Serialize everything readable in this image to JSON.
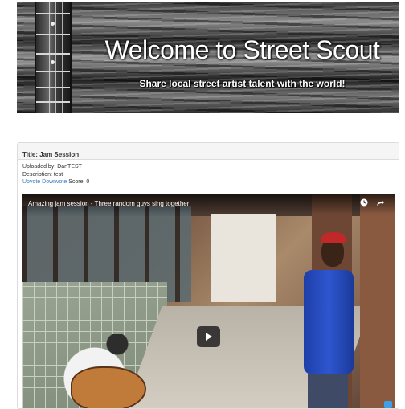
{
  "banner": {
    "title": "Welcome to Street Scout",
    "subtitle": "Share local street artist talent with the world!"
  },
  "post": {
    "title": "Title: Jam Session",
    "uploaded_by": "Uploaded by: DanTEST",
    "description": "Description: test",
    "upvote_label": "Upvote",
    "downvote_label": "Downvote",
    "score": "Score: 0"
  },
  "video": {
    "title": "Amazing jam session - Three random guys sing together",
    "icons": [
      "clock-icon",
      "share-icon",
      "play-icon"
    ]
  },
  "colors": {
    "link": "#337ab7",
    "panel_heading_bg": "#f5f5f5",
    "panel_border": "#dcdcdc"
  }
}
